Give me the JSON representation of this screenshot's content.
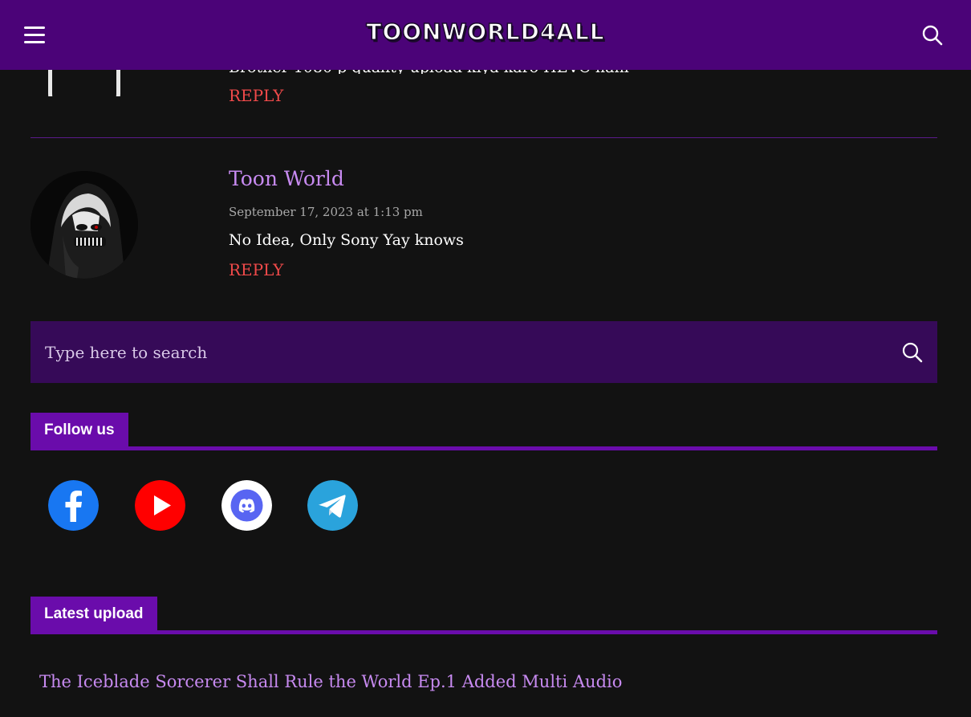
{
  "header": {
    "logo_text": "Toonworld4all",
    "menu_icon": "hamburger-menu-icon",
    "search_icon": "search-icon",
    "background": "#4b0378"
  },
  "comments": [
    {
      "text_partial": "Brother 1080 p quality upload kiya karo HEVC nahi",
      "reply_label": "REPLY"
    },
    {
      "author": "Toon World",
      "date": "September 17, 2023 at 1:13 pm",
      "text": "No Idea, Only Sony Yay knows",
      "reply_label": "REPLY"
    }
  ],
  "search": {
    "placeholder": "Type here to search",
    "submit_icon": "search-icon"
  },
  "follow": {
    "title": "Follow us",
    "socials": [
      {
        "name": "facebook",
        "icon": "facebook-icon",
        "color": "#1877f2"
      },
      {
        "name": "youtube",
        "icon": "youtube-icon",
        "color": "#ff0000"
      },
      {
        "name": "discord",
        "icon": "discord-icon",
        "color": "#5865f2"
      },
      {
        "name": "telegram",
        "icon": "telegram-icon",
        "color": "#2aa3dc"
      }
    ]
  },
  "latest": {
    "title": "Latest upload",
    "items": [
      {
        "label": "The Iceblade Sorcerer Shall Rule the World Ep.1 Added Multi Audio"
      }
    ]
  },
  "colors": {
    "accent": "#6a0cab",
    "link": "#c78af0",
    "reply": "#f04a4a",
    "page_bg": "#121212"
  }
}
